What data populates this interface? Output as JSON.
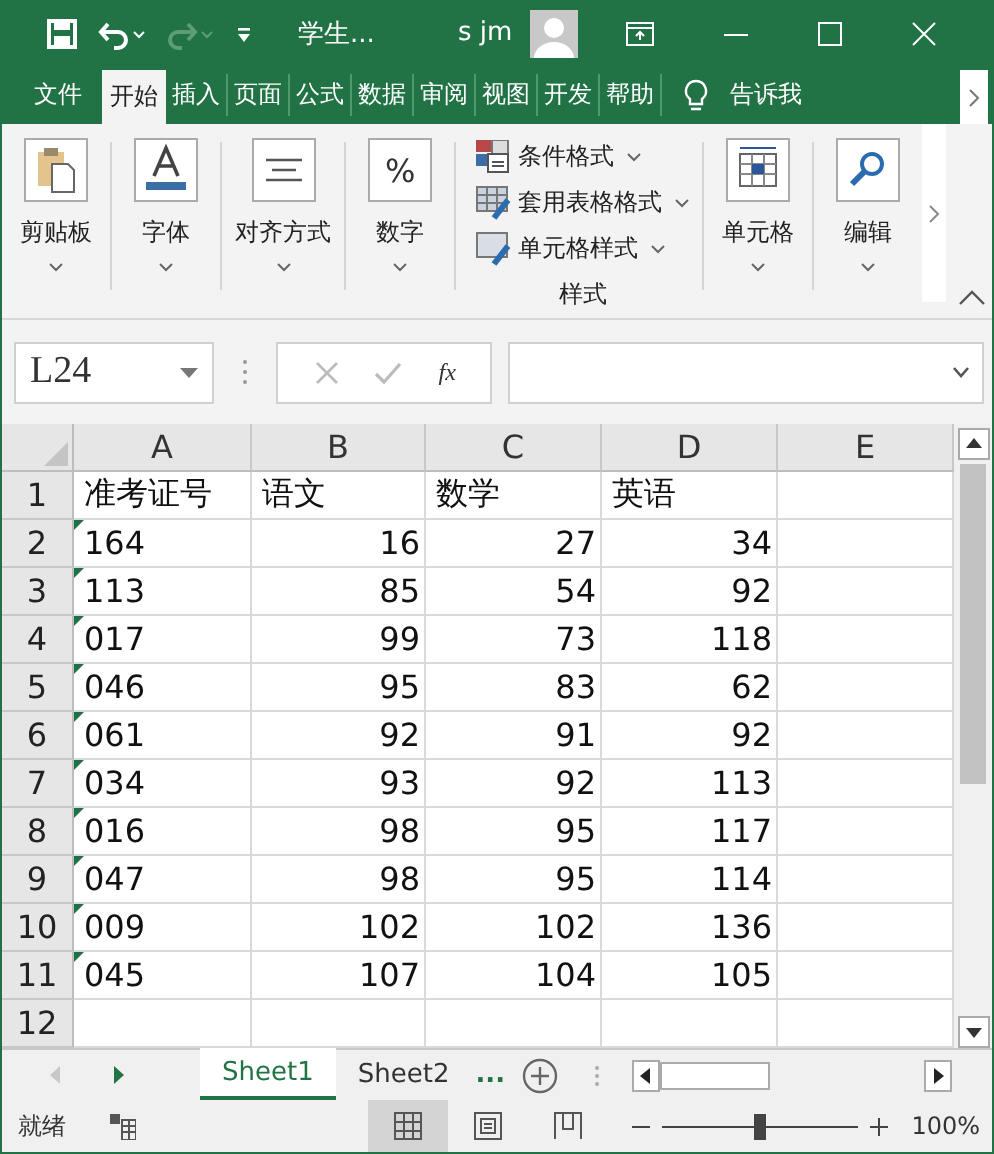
{
  "title_bar": {
    "title": "学生...",
    "user": "s jm"
  },
  "ribbon_tabs": [
    {
      "label": "文件",
      "selected": false
    },
    {
      "label": "开始",
      "selected": true
    },
    {
      "label": "插入",
      "selected": false
    },
    {
      "label": "页面",
      "selected": false
    },
    {
      "label": "公式",
      "selected": false
    },
    {
      "label": "数据",
      "selected": false
    },
    {
      "label": "审阅",
      "selected": false
    },
    {
      "label": "视图",
      "selected": false
    },
    {
      "label": "开发",
      "selected": false
    },
    {
      "label": "帮助",
      "selected": false
    }
  ],
  "tell_me": "告诉我",
  "ribbon_groups": [
    {
      "kind": "large",
      "label": "剪贴板"
    },
    {
      "kind": "large",
      "label": "字体"
    },
    {
      "kind": "large",
      "label": "对齐方式"
    },
    {
      "kind": "large",
      "label": "数字",
      "glyph": "%"
    },
    {
      "kind": "stack",
      "label": "样式",
      "items": [
        {
          "text": "条件格式"
        },
        {
          "text": "套用表格格式"
        },
        {
          "text": "单元格样式"
        }
      ]
    },
    {
      "kind": "large",
      "label": "单元格"
    },
    {
      "kind": "large",
      "label": "编辑"
    }
  ],
  "formula_bar": {
    "name_box": "L24",
    "function_label": "fx"
  },
  "grid": {
    "columns": [
      "A",
      "B",
      "C",
      "D",
      "E"
    ],
    "rows": [
      {
        "header": "1",
        "flagged": false,
        "cells": [
          "准考证号",
          "语文",
          "数学",
          "英语"
        ]
      },
      {
        "header": "2",
        "flagged": true,
        "cells": [
          "164",
          "16",
          "27",
          "34"
        ]
      },
      {
        "header": "3",
        "flagged": true,
        "cells": [
          "113",
          "85",
          "54",
          "92"
        ]
      },
      {
        "header": "4",
        "flagged": true,
        "cells": [
          "017",
          "99",
          "73",
          "118"
        ]
      },
      {
        "header": "5",
        "flagged": true,
        "cells": [
          "046",
          "95",
          "83",
          "62"
        ]
      },
      {
        "header": "6",
        "flagged": true,
        "cells": [
          "061",
          "92",
          "91",
          "92"
        ]
      },
      {
        "header": "7",
        "flagged": true,
        "cells": [
          "034",
          "93",
          "92",
          "113"
        ]
      },
      {
        "header": "8",
        "flagged": true,
        "cells": [
          "016",
          "98",
          "95",
          "117"
        ]
      },
      {
        "header": "9",
        "flagged": true,
        "cells": [
          "047",
          "98",
          "95",
          "114"
        ]
      },
      {
        "header": "10",
        "flagged": true,
        "cells": [
          "009",
          "102",
          "102",
          "136"
        ]
      },
      {
        "header": "11",
        "flagged": true,
        "cells": [
          "045",
          "107",
          "104",
          "105"
        ]
      },
      {
        "header": "12",
        "flagged": false,
        "cells": []
      }
    ]
  },
  "sheet_tabs": [
    {
      "label": "Sheet1",
      "selected": true
    },
    {
      "label": "Sheet2",
      "selected": false
    }
  ],
  "more_sheets": "...",
  "status_bar": {
    "status": "就绪",
    "views": [
      {
        "kind": "normal",
        "selected": true
      },
      {
        "kind": "page_layout",
        "selected": false
      },
      {
        "kind": "page_break",
        "selected": false
      }
    ],
    "zoom": {
      "level": 0.5,
      "reading": "100%"
    }
  }
}
